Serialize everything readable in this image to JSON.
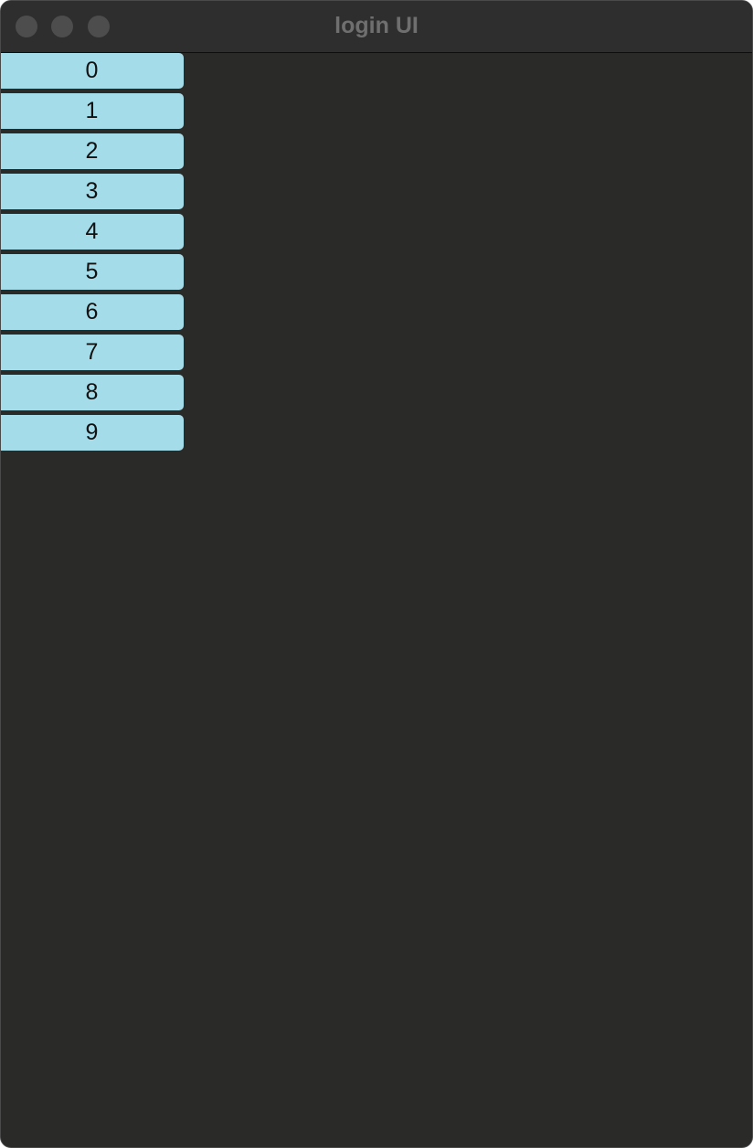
{
  "window": {
    "title": "login UI"
  },
  "theme": {
    "background": "#2a2a28",
    "titlebar": "#2e2e2e",
    "button": "#a4dcea",
    "title_text": "#6f6f6f"
  },
  "buttons": [
    {
      "label": "0"
    },
    {
      "label": "1"
    },
    {
      "label": "2"
    },
    {
      "label": "3"
    },
    {
      "label": "4"
    },
    {
      "label": "5"
    },
    {
      "label": "6"
    },
    {
      "label": "7"
    },
    {
      "label": "8"
    },
    {
      "label": "9"
    }
  ]
}
